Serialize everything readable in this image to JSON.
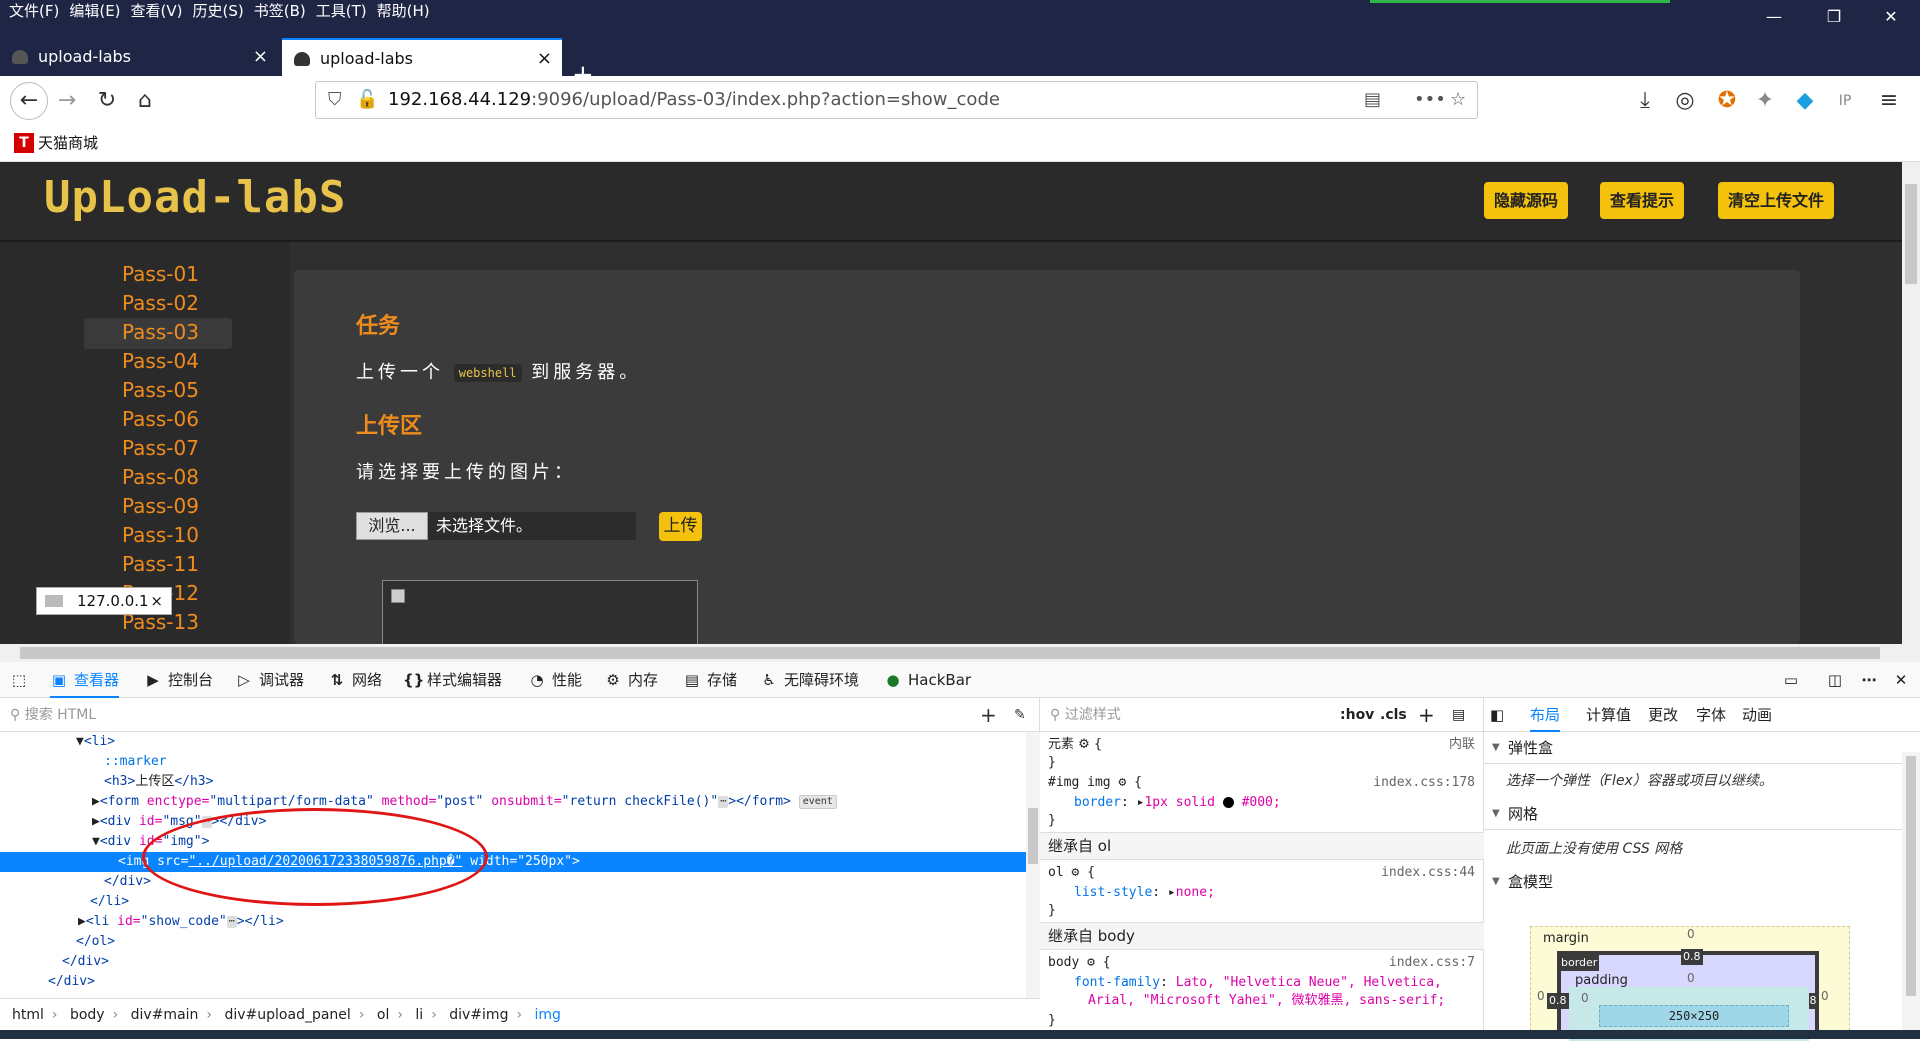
{
  "menubar": {
    "items": [
      "文件(F)",
      "编辑(E)",
      "查看(V)",
      "历史(S)",
      "书签(B)",
      "工具(T)",
      "帮助(H)"
    ]
  },
  "tabs": [
    {
      "label": "upload-labs",
      "close": "×"
    },
    {
      "label": "upload-labs",
      "close": "×"
    }
  ],
  "newtab": "+",
  "url": {
    "host": "192.168.44.129",
    "rest": ":9096/upload/Pass-03/index.php?action=show_code"
  },
  "bookmarks": [
    {
      "icon": "T",
      "label": "天猫商城"
    }
  ],
  "logo": "UpLoad-labS",
  "header_buttons": [
    "隐藏源码",
    "查看提示",
    "清空上传文件"
  ],
  "passes": [
    "Pass-01",
    "Pass-02",
    "Pass-03",
    "Pass-04",
    "Pass-05",
    "Pass-06",
    "Pass-07",
    "Pass-08",
    "Pass-09",
    "Pass-10",
    "Pass-11",
    "Pass-12",
    "Pass-13"
  ],
  "selected_pass": "Pass-03",
  "panel": {
    "task_title": "任务",
    "task_text_a": "上传一个",
    "task_code": "webshell",
    "task_text_b": "到服务器。",
    "upload_title": "上传区",
    "choose_text": "请选择要上传的图片：",
    "browse_label": "浏览...",
    "no_file": "未选择文件。",
    "upload_button": "上传"
  },
  "tooltip": {
    "text": "127.0.0.1",
    "close": "×"
  },
  "devtools": {
    "tabs": [
      "查看器",
      "控制台",
      "调试器",
      "网络",
      "样式编辑器",
      "性能",
      "内存",
      "存储",
      "无障碍环境",
      "HackBar"
    ],
    "search_placeholder": "搜索 HTML",
    "filter_placeholder": "过滤样式"
  },
  "tree": [
    {
      "indent": 1,
      "tw": "▼",
      "html": "li"
    },
    {
      "indent": 2,
      "text": "::marker"
    },
    {
      "indent": 2,
      "h3": "上传区"
    },
    {
      "indent": 1,
      "tw": "▶",
      "form": true
    },
    {
      "indent": 1,
      "tw": "▶",
      "divmsg": true
    },
    {
      "indent": 1,
      "tw": "▼",
      "divimg": true
    },
    {
      "indent": 2,
      "img": true
    },
    {
      "indent": 2,
      "close": "div"
    },
    {
      "indent": 1,
      "close": "li"
    },
    {
      "indent": 1,
      "tw": "▶",
      "lishow": true
    },
    {
      "indent": 0,
      "close": "ol"
    },
    {
      "indent": -1,
      "close": "div"
    },
    {
      "indent": -2,
      "close": "div"
    }
  ],
  "html_strings": {
    "li_open": "<li>",
    "marker": "::marker",
    "h3_open": "<h3>",
    "h3_text": "上传区",
    "h3_close": "</h3>",
    "form_tag": "<form",
    "form_enctype": "enctype=",
    "form_enctype_v": "\"multipart/form-data\"",
    "form_method": "method=",
    "form_method_v": "\"post\"",
    "form_onsubmit": "onsubmit=",
    "form_onsubmit_v": "\"return checkFile()\"",
    "form_close": "></form>",
    "event": "event",
    "divmsg_tag": "<div",
    "divmsg_id": "id=",
    "divmsg_v": "\"msg\"",
    "divmsg_close": "></div>",
    "divimg_tag": "<div",
    "divimg_id": "id=",
    "divimg_v": "\"img\"",
    "divimg_close": ">",
    "img_tag": "<img",
    "img_src": "src=",
    "img_src_v": "\"../upload/202006172338059876.php�\"",
    "img_width": "width=",
    "img_width_v": "\"250px\"",
    "img_close": ">",
    "div_end": "</div>",
    "li_end": "</li>",
    "lishow_tag": "<li",
    "lishow_id": "id=",
    "lishow_v": "\"show_code\"",
    "lishow_close": "></li>",
    "ol_end": "</ol>"
  },
  "crumbs": [
    "html",
    "body",
    "div#main",
    "div#upload_panel",
    "ol",
    "li",
    "div#img",
    "img"
  ],
  "rules": {
    "element": "元素",
    "inline": "内联",
    "r1_sel": "#img img",
    "r1_src": "index.css:178",
    "r1_prop": "border",
    "r1_val": "1px solid",
    "r1_color": "#000;",
    "h_ol": "继承自 ol",
    "r2_sel": "ol",
    "r2_src": "index.css:44",
    "r2_prop": "list-style",
    "r2_val": "none;",
    "h_body": "继承自 body",
    "r3_sel": "body",
    "r3_src": "index.css:7",
    "r3_prop": "font-family",
    "r3_val1": "Lato, \"Helvetica Neue\", Helvetica,",
    "r3_val2": "Arial, \"Microsoft Yahei\", 微软雅黑, sans-serif;"
  },
  "layout": {
    "tabs": [
      "布局",
      "计算值",
      "更改",
      "字体",
      "动画"
    ],
    "flex_title": "弹性盒",
    "flex_note": "选择一个弹性（Flex）容器或项目以继续。",
    "grid_title": "网格",
    "grid_note": "此页面上没有使用 CSS 网格",
    "box_title": "盒模型",
    "margin": "margin",
    "border": "border",
    "padding": "padding",
    "content": "250×250",
    "m_top": "0",
    "b_top": "0.8",
    "p_top": "0",
    "m_left": "0",
    "b_left": "0.8",
    "p_left": "0",
    "b_right": "0.8",
    "m_right": "0"
  },
  "colors": {
    "accent": "#f08c1e",
    "button": "#f4c20d",
    "chrome": "#1e2545",
    "link": "#0a84ff"
  }
}
